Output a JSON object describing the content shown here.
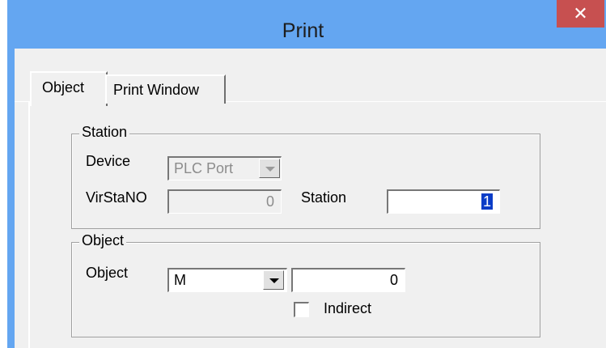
{
  "window": {
    "title": "Print",
    "close_glyph": "✕"
  },
  "tabs": [
    {
      "label": "Object"
    },
    {
      "label": "Print Window"
    }
  ],
  "station_group": {
    "title": "Station",
    "device_label": "Device",
    "device_value": "PLC Port",
    "virsta_label": "VirStaNO",
    "virsta_value": "0",
    "station_label": "Station",
    "station_value": "1"
  },
  "object_group": {
    "title": "Object",
    "object_label": "Object",
    "object_type": "M",
    "object_address": "0",
    "indirect_label": "Indirect",
    "indirect_checked": false
  }
}
